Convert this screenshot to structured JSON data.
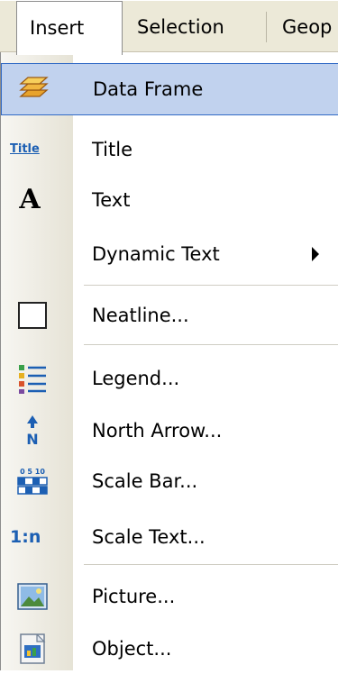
{
  "menubar": {
    "items": [
      {
        "label": "Insert"
      },
      {
        "label": "Selection"
      },
      {
        "label": "Geop"
      }
    ]
  },
  "menu": {
    "items": [
      {
        "label": "Data Frame",
        "icon": "data-frame-icon",
        "highlighted": true
      },
      {
        "label": "Title",
        "icon": "title-icon"
      },
      {
        "label": "Text",
        "icon": "text-icon"
      },
      {
        "label": "Dynamic Text",
        "icon": "",
        "submenu": true
      },
      {
        "label": "Neatline...",
        "icon": "neatline-icon"
      },
      {
        "label": "Legend...",
        "icon": "legend-icon"
      },
      {
        "label": "North Arrow...",
        "icon": "north-arrow-icon"
      },
      {
        "label": "Scale Bar...",
        "icon": "scale-bar-icon"
      },
      {
        "label": "Scale Text...",
        "icon": "scale-text-icon"
      },
      {
        "label": "Picture...",
        "icon": "picture-icon"
      },
      {
        "label": "Object...",
        "icon": "object-icon"
      }
    ],
    "icon_text": {
      "title": "Title",
      "text": "A",
      "north": "N",
      "scale_ticks": "0 5 10",
      "scale_text": "1:n"
    }
  },
  "colors": {
    "menubar_bg": "#ece9d8",
    "highlight_bg": "#c1d2ee",
    "highlight_border": "#316ac5",
    "icon_blue": "#1c5fb3"
  }
}
